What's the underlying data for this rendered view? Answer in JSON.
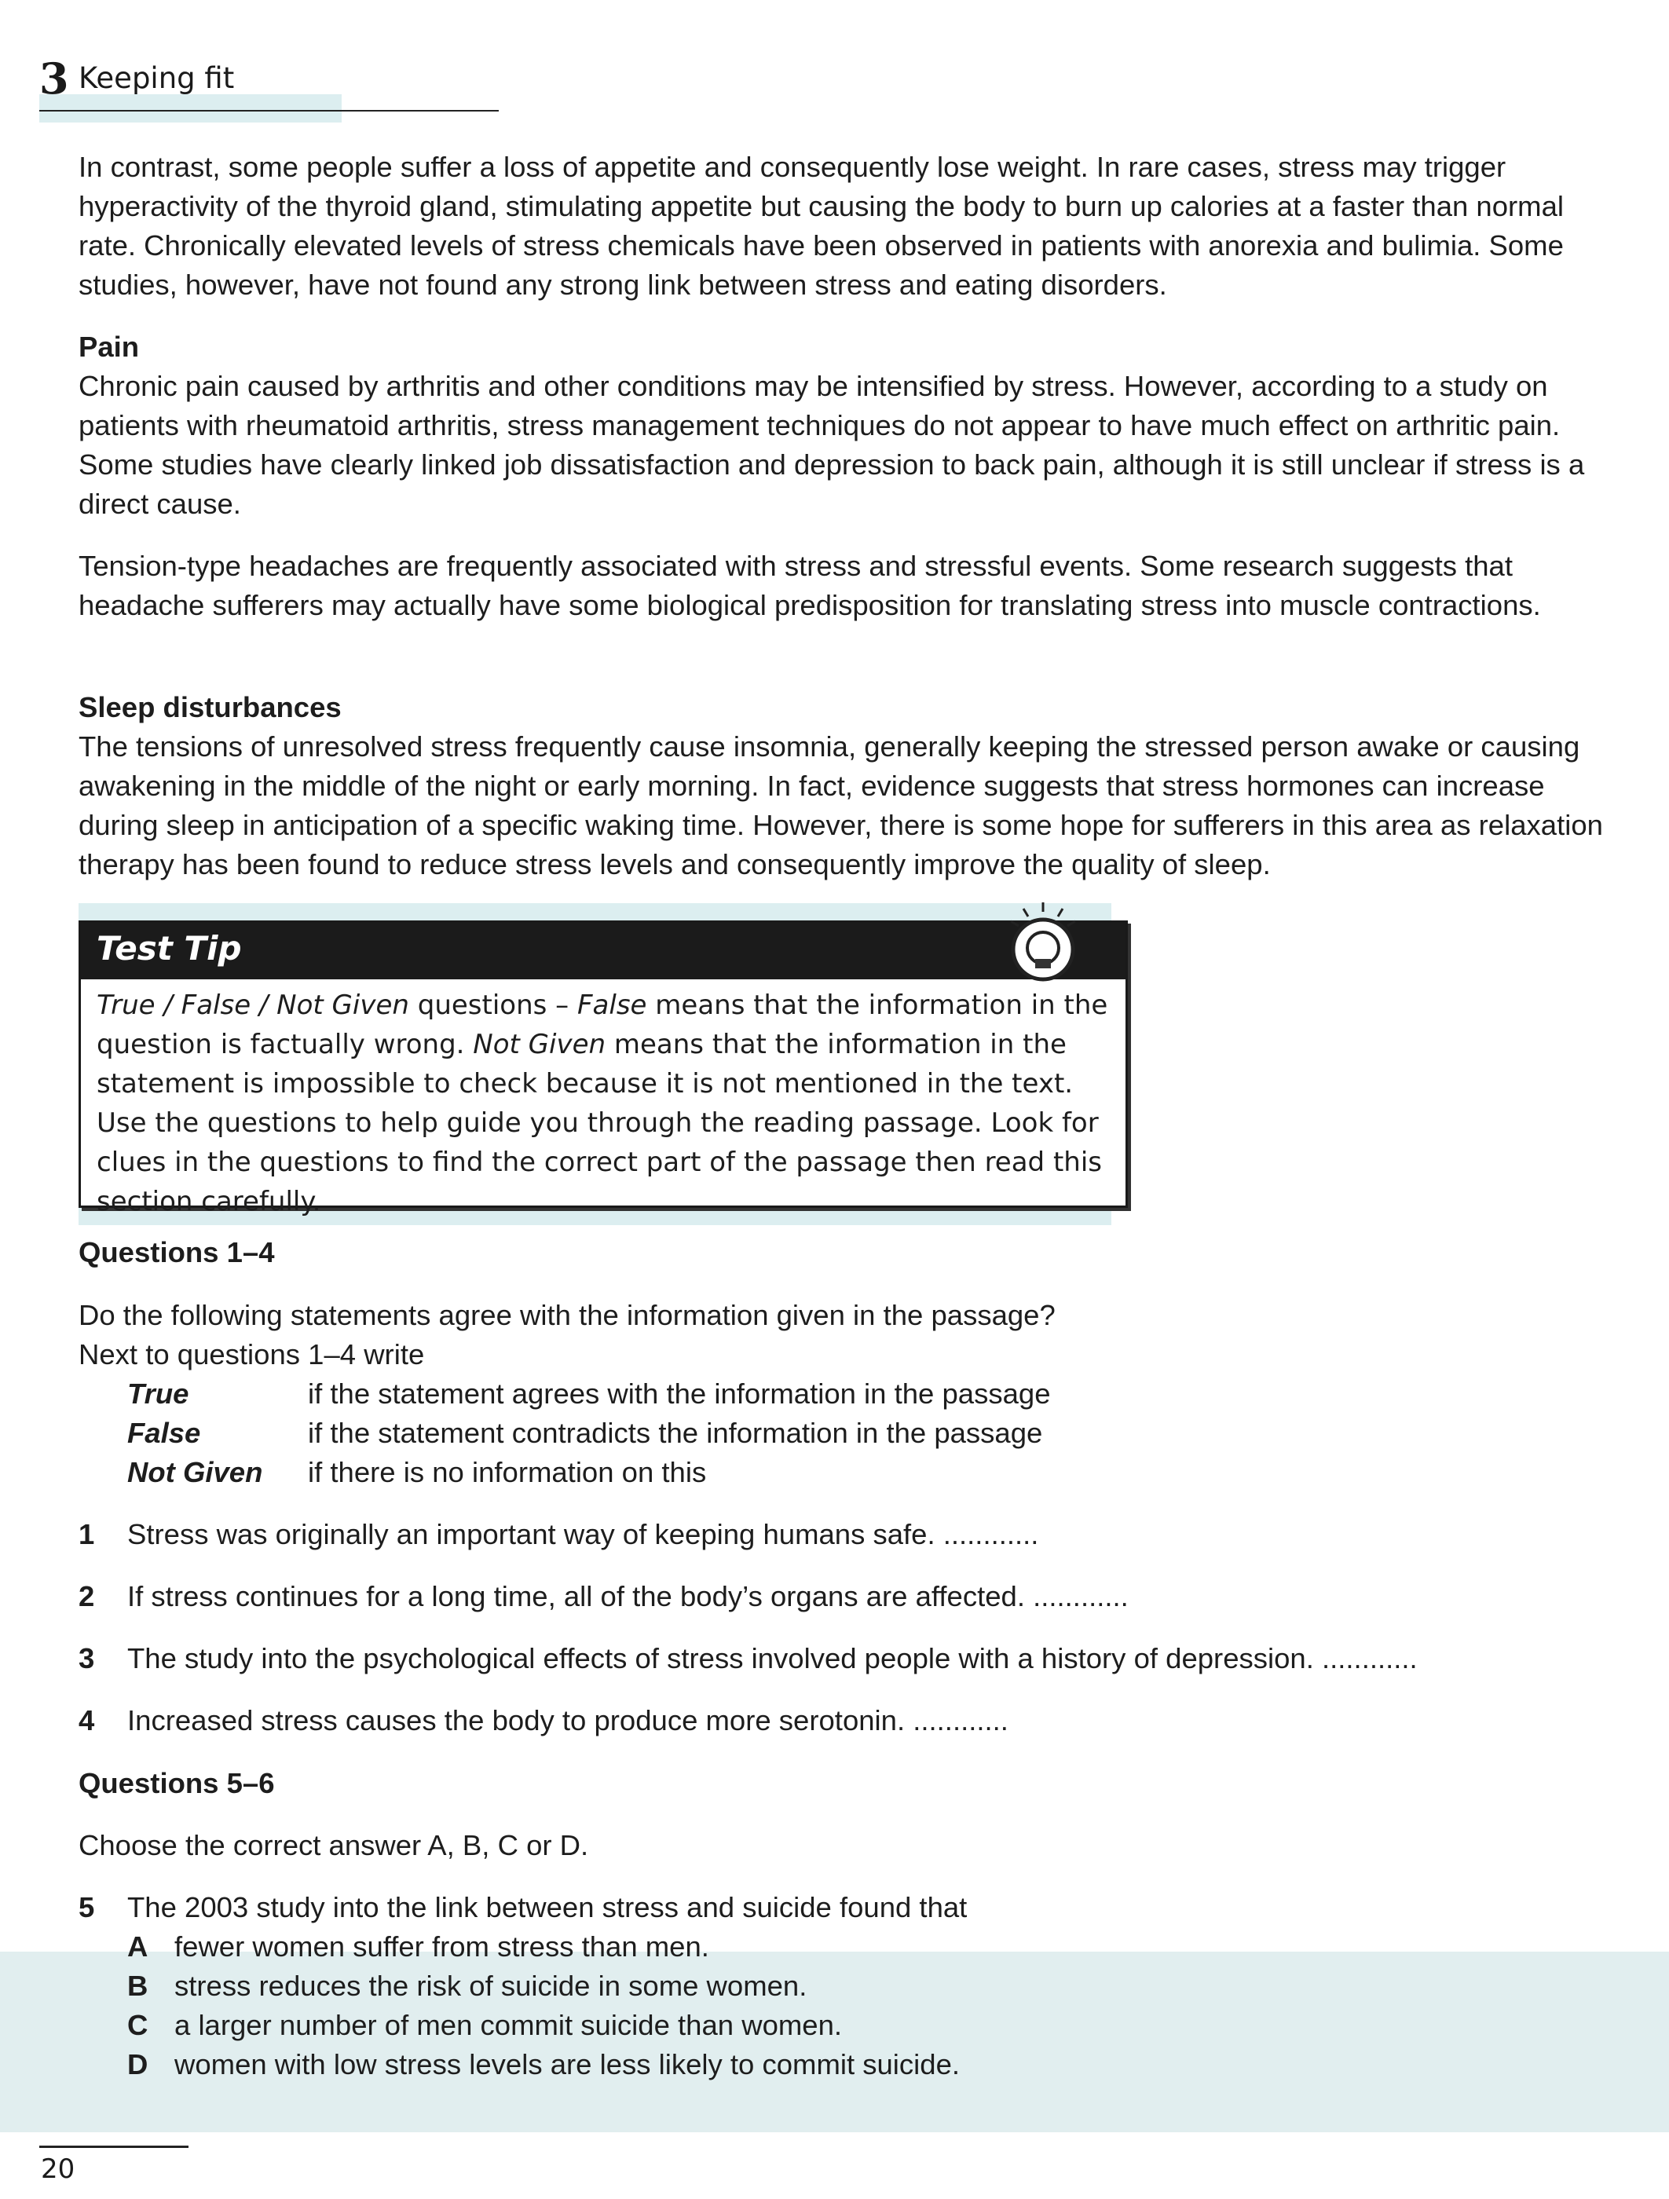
{
  "header": {
    "chapter_number": "3",
    "chapter_title": "Keeping fit"
  },
  "passage": {
    "para1": "In contrast, some people suffer a loss of appetite and consequently lose weight. In rare cases, stress may trigger hyperactivity of the thyroid gland, stimulating appetite but causing the body to burn up calories at a faster than normal rate. Chronically elevated levels of stress chemicals have been observed in patients with anorexia and bulimia. Some studies, however, have not found any strong link between stress and eating disorders.",
    "pain_heading": "Pain",
    "pain_para": "Chronic pain caused by arthritis and other conditions may be intensified by stress. However, according to a study on patients with rheumatoid arthritis, stress management techniques do not appear to have much effect on arthritic pain. Some studies have clearly linked job dissatisfaction and depression to back pain, although it is still unclear if stress is a direct cause.",
    "headache_para": "Tension-type headaches are frequently associated with stress and stressful events. Some research suggests that headache sufferers may actually have some biological predisposition for translating stress into muscle contractions.",
    "sleep_heading": "Sleep disturbances",
    "sleep_para": "The tensions of unresolved stress frequently cause insomnia, generally keeping the stressed person awake or causing awakening in the middle of the night or early morning. In fact, evidence suggests that stress hormones can increase during sleep in anticipation of a specific waking time. However, there is some hope for sufferers in this area as relaxation therapy has been found to reduce stress levels and consequently improve the quality of sleep."
  },
  "test_tip": {
    "title": "Test Tip",
    "text_1": "True / False / Not Given",
    "text_2": " questions – ",
    "text_3": "False",
    "text_4": " means that the information in the question is factually wrong. ",
    "text_5": "Not Given",
    "text_6": " means that the information in the statement is impossible to check because it is not mentioned in the text. Use the questions to help guide you through the reading passage. Look for clues in the questions to find the correct part of the passage then read this section carefully."
  },
  "section1": {
    "heading": "Questions 1–4",
    "instruction_1": "Do the following statements agree with the information given in the passage?",
    "instruction_2": "Next to questions 1–4 write",
    "key": [
      {
        "term": "True",
        "desc": "if the statement agrees with the information in the passage"
      },
      {
        "term": "False",
        "desc": "if the statement contradicts the information in the passage"
      },
      {
        "term": "Not Given",
        "desc": "if there is no information on this"
      }
    ],
    "questions": [
      {
        "num": "1",
        "text": "Stress was originally an important way of keeping humans safe. ............"
      },
      {
        "num": "2",
        "text": "If stress continues for a long time, all of the body’s organs are affected. ............"
      },
      {
        "num": "3",
        "text": "The study into the psychological effects of stress involved people with a history of depression. ............"
      },
      {
        "num": "4",
        "text": "Increased stress causes the body to produce more serotonin. ............"
      }
    ]
  },
  "section2": {
    "heading": "Questions 5–6",
    "instruction": "Choose the correct answer A, B, C or D.",
    "question": {
      "num": "5",
      "text": "The 2003 study into the link between stress and suicide found that"
    },
    "options": [
      {
        "letter": "A",
        "text": "fewer women suffer from stress than men."
      },
      {
        "letter": "B",
        "text": "stress reduces the risk of suicide in some women."
      },
      {
        "letter": "C",
        "text": "a larger number of men commit suicide than women."
      },
      {
        "letter": "D",
        "text": "women with low stress levels are less likely to commit suicide."
      }
    ]
  },
  "footer": {
    "page_number": "20"
  }
}
